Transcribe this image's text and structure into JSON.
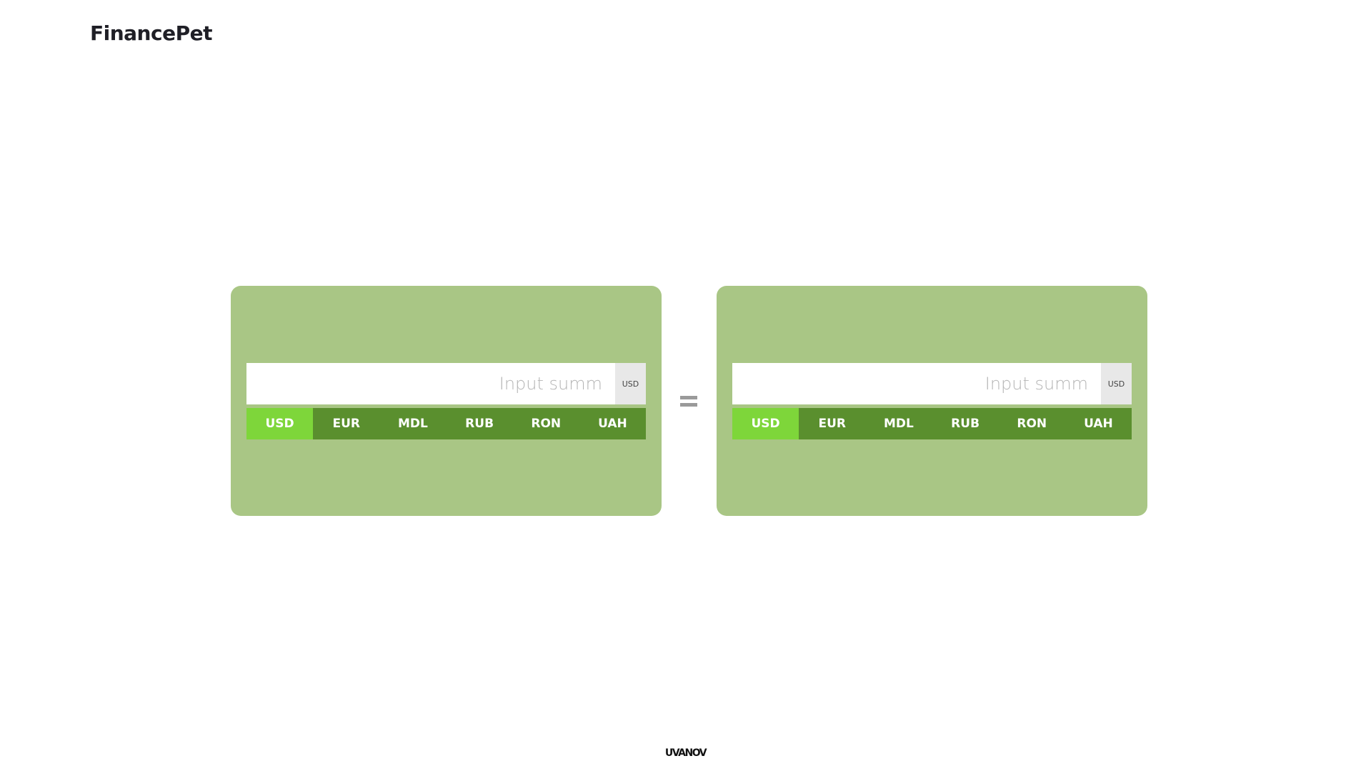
{
  "header": {
    "logo": "FinancePet"
  },
  "converter": {
    "left": {
      "input_placeholder": "Input summ",
      "input_value": "",
      "unit": "USD",
      "currencies": [
        "USD",
        "EUR",
        "MDL",
        "RUB",
        "RON",
        "UAH"
      ],
      "selected": "USD"
    },
    "right": {
      "input_placeholder": "Input summ",
      "input_value": "",
      "unit": "USD",
      "currencies": [
        "USD",
        "EUR",
        "MDL",
        "RUB",
        "RON",
        "UAH"
      ],
      "selected": "USD"
    },
    "equals_symbol": "="
  },
  "footer": {
    "brand": "UVANOV"
  },
  "colors": {
    "card_bg": "#a9c685",
    "currency_bar": "#5a8f2e",
    "currency_active": "#7ed63a",
    "unit_badge_bg": "#e8e8e8",
    "equals_color": "#9a9a9a"
  }
}
